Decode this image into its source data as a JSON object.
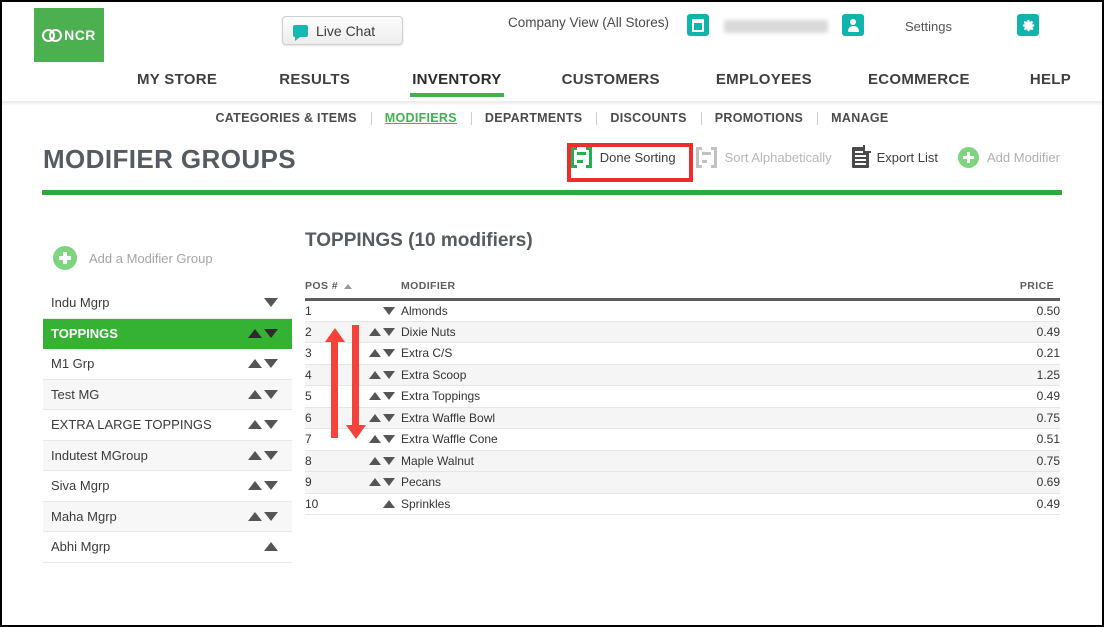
{
  "topbar": {
    "logo_text": "NCR",
    "live_chat_label": "Live Chat",
    "company_view_label": "Company View (All Stores)",
    "user_name_redacted": "",
    "settings_label": "Settings"
  },
  "mainnav": {
    "items": [
      {
        "label": "MY STORE",
        "active": false
      },
      {
        "label": "RESULTS",
        "active": false
      },
      {
        "label": "INVENTORY",
        "active": true
      },
      {
        "label": "CUSTOMERS",
        "active": false
      },
      {
        "label": "EMPLOYEES",
        "active": false
      },
      {
        "label": "ECOMMERCE",
        "active": false
      },
      {
        "label": "HELP",
        "active": false
      }
    ]
  },
  "subnav": {
    "items": [
      {
        "label": "CATEGORIES & ITEMS",
        "active": false
      },
      {
        "label": "MODIFIERS",
        "active": true
      },
      {
        "label": "DEPARTMENTS",
        "active": false
      },
      {
        "label": "DISCOUNTS",
        "active": false
      },
      {
        "label": "PROMOTIONS",
        "active": false
      },
      {
        "label": "MANAGE",
        "active": false
      }
    ]
  },
  "page": {
    "title": "MODIFIER GROUPS",
    "accent_green": "#2fa93d",
    "highlight_red": "#f02d2d"
  },
  "actions": {
    "done_sorting": "Done Sorting",
    "sort_alphabetically": "Sort Alphabetically",
    "export_list": "Export List",
    "add_modifier": "Add Modifier"
  },
  "sidebar": {
    "add_group_label": "Add a Modifier Group",
    "groups": [
      {
        "label": "Indu Mgrp",
        "selected": false,
        "up": false,
        "down": true
      },
      {
        "label": "TOPPINGS",
        "selected": true,
        "up": true,
        "down": true
      },
      {
        "label": "M1 Grp",
        "selected": false,
        "up": true,
        "down": true
      },
      {
        "label": "Test MG",
        "selected": false,
        "up": true,
        "down": true
      },
      {
        "label": "EXTRA LARGE TOPPINGS",
        "selected": false,
        "up": true,
        "down": true
      },
      {
        "label": "Indutest MGroup",
        "selected": false,
        "up": true,
        "down": true
      },
      {
        "label": "Siva Mgrp",
        "selected": false,
        "up": true,
        "down": true
      },
      {
        "label": "Maha Mgrp",
        "selected": false,
        "up": true,
        "down": true
      },
      {
        "label": "Abhi Mgrp",
        "selected": false,
        "up": true,
        "down": false
      }
    ]
  },
  "panel": {
    "title": "TOPPINGS (10 modifiers)",
    "columns": {
      "pos": "POS #",
      "modifier": "MODIFIER",
      "price": "PRICE"
    },
    "rows": [
      {
        "pos": "1",
        "modifier": "Almonds",
        "price": "0.50",
        "up": false,
        "down": true
      },
      {
        "pos": "2",
        "modifier": "Dixie Nuts",
        "price": "0.49",
        "up": true,
        "down": true
      },
      {
        "pos": "3",
        "modifier": "Extra C/S",
        "price": "0.21",
        "up": true,
        "down": true
      },
      {
        "pos": "4",
        "modifier": "Extra Scoop",
        "price": "1.25",
        "up": true,
        "down": true
      },
      {
        "pos": "5",
        "modifier": "Extra Toppings",
        "price": "0.49",
        "up": true,
        "down": true
      },
      {
        "pos": "6",
        "modifier": "Extra Waffle Bowl",
        "price": "0.75",
        "up": true,
        "down": true
      },
      {
        "pos": "7",
        "modifier": "Extra Waffle Cone",
        "price": "0.51",
        "up": true,
        "down": true
      },
      {
        "pos": "8",
        "modifier": "Maple Walnut",
        "price": "0.75",
        "up": true,
        "down": true
      },
      {
        "pos": "9",
        "modifier": "Pecans",
        "price": "0.69",
        "up": true,
        "down": true
      },
      {
        "pos": "10",
        "modifier": "Sprinkles",
        "price": "0.49",
        "up": true,
        "down": false
      }
    ]
  }
}
